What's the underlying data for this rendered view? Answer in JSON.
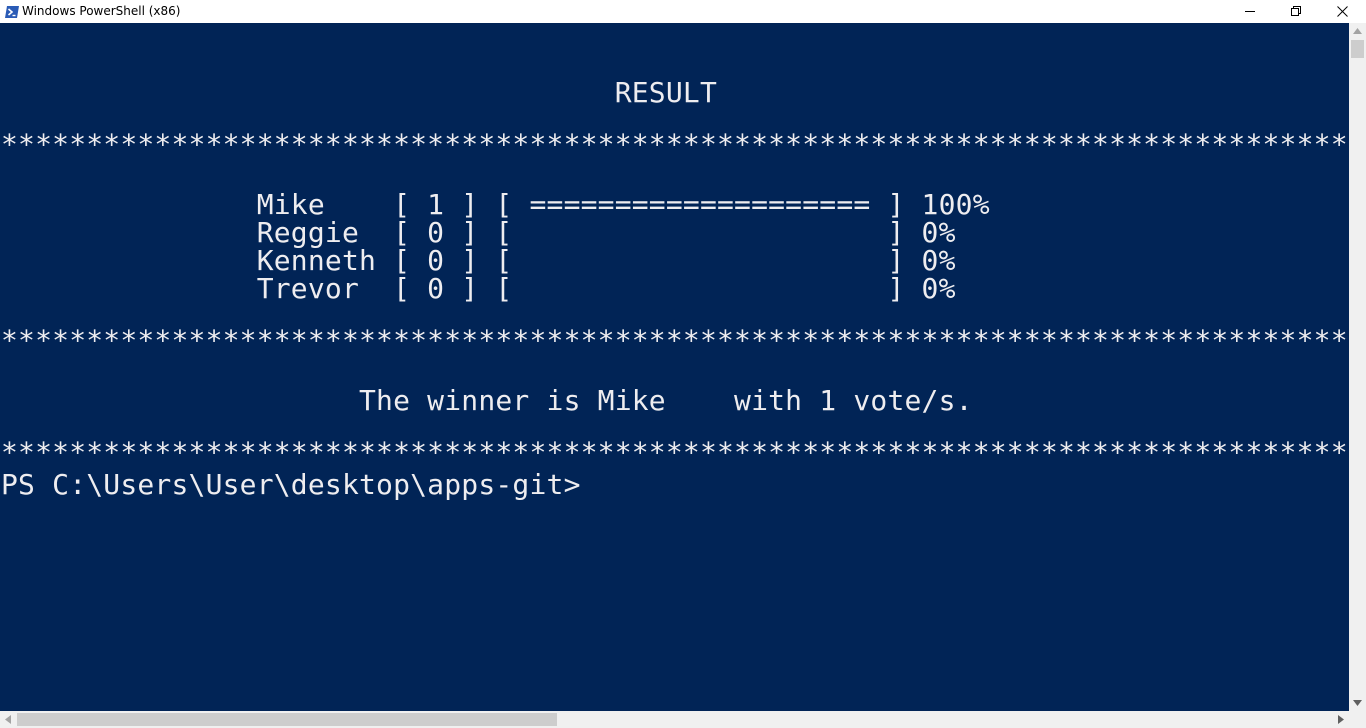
{
  "window": {
    "title": "Windows PowerShell (x86)",
    "icon": "powershell-icon",
    "controls": [
      "minimize-icon",
      "restore-icon",
      "close-icon"
    ]
  },
  "colors": {
    "console_background": "#012456",
    "console_text": "#eeedf0"
  },
  "console": {
    "heading": "                                    RESULT",
    "separator": "****************************************************************************************************",
    "results": [
      {
        "text": "               Mike    [ 1 ] [ ==================== ] 100%",
        "name": "Mike",
        "votes": 1,
        "percent": "100%"
      },
      {
        "text": "               Reggie  [ 0 ] [                      ] 0%",
        "name": "Reggie",
        "votes": 0,
        "percent": "0%"
      },
      {
        "text": "               Kenneth [ 0 ] [                      ] 0%",
        "name": "Kenneth",
        "votes": 0,
        "percent": "0%"
      },
      {
        "text": "               Trevor  [ 0 ] [                      ] 0%",
        "name": "Trevor",
        "votes": 0,
        "percent": "0%"
      }
    ],
    "winner_line": "                     The winner is Mike    with 1 vote/s.",
    "prompt": "PS C:\\Users\\User\\desktop\\apps-git>"
  },
  "scrollbars": {
    "vertical_icons": [
      "scroll-up-arrow-icon",
      "scroll-down-arrow-icon"
    ],
    "horizontal_icons": [
      "scroll-left-arrow-icon",
      "scroll-right-arrow-icon"
    ]
  }
}
